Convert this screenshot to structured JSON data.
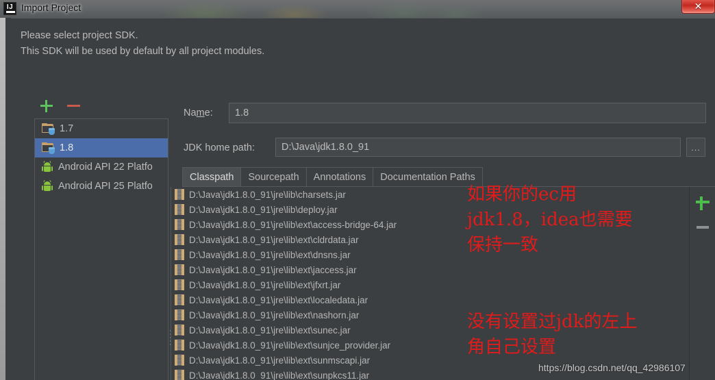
{
  "window": {
    "title": "Import Project",
    "logo_text": "IJ",
    "close_label": "✕"
  },
  "header": {
    "message": "Please select project SDK.\nThis SDK will be used by default by all project modules."
  },
  "sdk_toolbar": {
    "add_label": "+",
    "remove_label": "−"
  },
  "sdk_list": {
    "items": [
      {
        "label": "1.7",
        "icon": "jdk-folder-icon",
        "selected": false
      },
      {
        "label": "1.8",
        "icon": "jdk-folder-icon",
        "selected": true
      },
      {
        "label": "Android API 22 Platfo",
        "icon": "android-icon",
        "selected": false
      },
      {
        "label": "Android API 25 Platfo",
        "icon": "android-icon",
        "selected": false
      }
    ]
  },
  "detail": {
    "name_label_pre": "Na",
    "name_label_mnemonic": "m",
    "name_label_post": "e:",
    "name_value": "1.8",
    "name_placeholder": "",
    "home_label": "JDK home path:",
    "home_value": "D:\\Java\\jdk1.8.0_91",
    "home_placeholder": "",
    "browse_label": "..."
  },
  "tabs": [
    {
      "label": "Classpath",
      "active": true
    },
    {
      "label": "Sourcepath",
      "active": false
    },
    {
      "label": "Annotations",
      "active": false
    },
    {
      "label": "Documentation Paths",
      "active": false
    }
  ],
  "classpath": {
    "add_label": "+",
    "remove_label": "−",
    "entries": [
      "D:\\Java\\jdk1.8.0_91\\jre\\lib\\charsets.jar",
      "D:\\Java\\jdk1.8.0_91\\jre\\lib\\deploy.jar",
      "D:\\Java\\jdk1.8.0_91\\jre\\lib\\ext\\access-bridge-64.jar",
      "D:\\Java\\jdk1.8.0_91\\jre\\lib\\ext\\cldrdata.jar",
      "D:\\Java\\jdk1.8.0_91\\jre\\lib\\ext\\dnsns.jar",
      "D:\\Java\\jdk1.8.0_91\\jre\\lib\\ext\\jaccess.jar",
      "D:\\Java\\jdk1.8.0_91\\jre\\lib\\ext\\jfxrt.jar",
      "D:\\Java\\jdk1.8.0_91\\jre\\lib\\ext\\localedata.jar",
      "D:\\Java\\jdk1.8.0_91\\jre\\lib\\ext\\nashorn.jar",
      "D:\\Java\\jdk1.8.0_91\\jre\\lib\\ext\\sunec.jar",
      "D:\\Java\\jdk1.8.0_91\\jre\\lib\\ext\\sunjce_provider.jar",
      "D:\\Java\\jdk1.8.0_91\\jre\\lib\\ext\\sunmscapi.jar",
      "D:\\Java\\jdk1.8.0_91\\jre\\lib\\ext\\sunpkcs11.jar"
    ]
  },
  "annotations": {
    "note_1": "如果你的ec用\njdk1.8，idea也需要\n保持一致",
    "note_2": "没有设置过jdk的左上\n角自己设置"
  },
  "watermark": {
    "url": "https://blog.csdn.net/qq_42986107"
  },
  "colors": {
    "selection_blue": "#4b6eab",
    "panel_bg": "#3c3f41",
    "field_bg": "#45484a",
    "text": "#bbbbbb",
    "accent_green": "#5ec25e",
    "accent_red": "#c95a4e",
    "annotation_red": "#e01b1b",
    "jar_icon": "#d2ab73",
    "android_green": "#8ac33e"
  }
}
